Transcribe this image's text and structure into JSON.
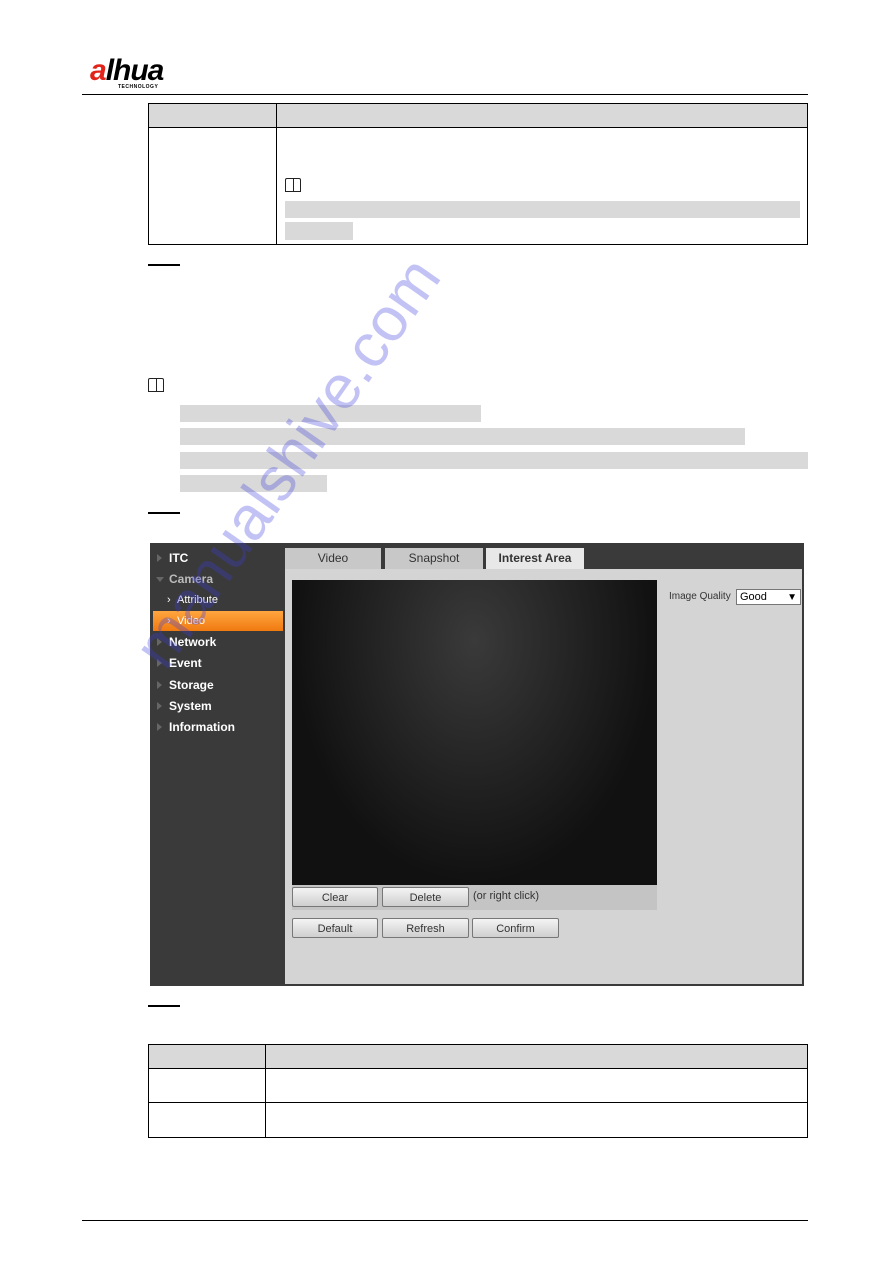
{
  "header": {
    "brand": "alhua",
    "brand_sub": "TECHNOLOGY"
  },
  "watermark": "manualshive.com",
  "ui": {
    "sidebar": [
      {
        "label": "ITC"
      },
      {
        "label": "Camera"
      },
      {
        "label": "Attribute"
      },
      {
        "label": "Video"
      },
      {
        "label": "Network"
      },
      {
        "label": "Event"
      },
      {
        "label": "Storage"
      },
      {
        "label": "System"
      },
      {
        "label": "Information"
      }
    ],
    "tabs": [
      {
        "label": "Video"
      },
      {
        "label": "Snapshot"
      },
      {
        "label": "Interest Area",
        "active": true
      }
    ],
    "image_quality_label": "Image Quality",
    "image_quality_value": "Good",
    "buttons": {
      "clear": "Clear",
      "delete": "Delete",
      "hint": "(or right click)",
      "default": "Default",
      "refresh": "Refresh",
      "confirm": "Confirm"
    },
    "active_color": "#f58a1f"
  }
}
